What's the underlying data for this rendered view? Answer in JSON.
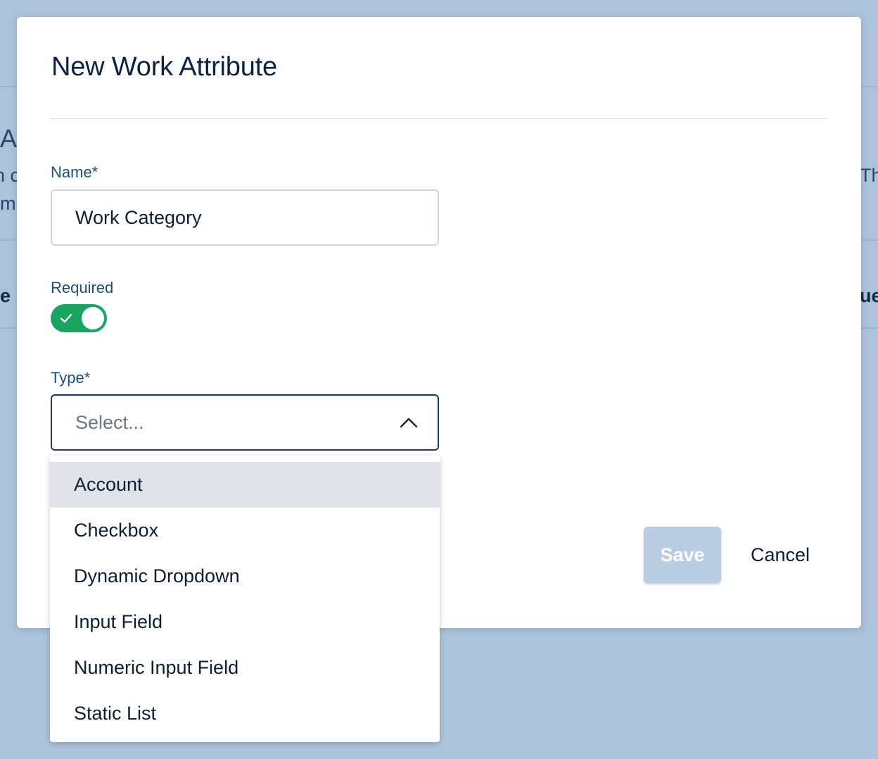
{
  "background": {
    "fragments": [
      "A",
      "n c",
      "m",
      "e",
      "Th",
      "ue"
    ]
  },
  "modal": {
    "title": "New Work Attribute",
    "name_field": {
      "label": "Name*",
      "value": "Work Category"
    },
    "required_field": {
      "label": "Required",
      "checked": true,
      "check_icon": "check-icon"
    },
    "type_field": {
      "label": "Type*",
      "placeholder": "Select...",
      "chevron_icon": "chevron-up-icon",
      "open": true,
      "options": [
        "Account",
        "Checkbox",
        "Dynamic Dropdown",
        "Input Field",
        "Numeric Input Field",
        "Static List"
      ],
      "highlighted_option": "Account"
    },
    "actions": {
      "save_label": "Save",
      "cancel_label": "Cancel",
      "save_disabled": true
    }
  },
  "colors": {
    "backdrop": "#adc3da",
    "label_blue": "#1a4f80",
    "toggle_on": "#18a55f",
    "save_disabled_bg": "#b9cde3",
    "option_highlight": "#e0e4ea"
  }
}
